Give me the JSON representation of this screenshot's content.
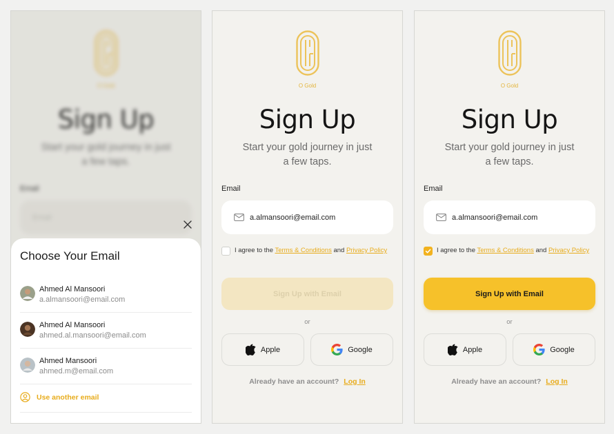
{
  "brand": {
    "name": "O Gold",
    "accent": "#f2b21e"
  },
  "signup": {
    "title": "Sign Up",
    "subtitle": "Start your gold journey in just a few taps.",
    "email_label": "Email",
    "email_placeholder": "Email",
    "email_value": "a.almansoori@email.com",
    "agree_prefix": "I agree to the",
    "terms_link": "Terms & Conditions",
    "agree_and": "and",
    "privacy_link": "Privacy Policy",
    "signup_button": "Sign Up with Email",
    "or": "or",
    "apple_button": "Apple",
    "google_button": "Google",
    "already_text": "Already have an account?",
    "login_link": "Log In"
  },
  "screens": [
    {
      "id": "choose-email",
      "agree_checked": false,
      "signup_enabled": false
    },
    {
      "id": "filled-unchecked",
      "agree_checked": false,
      "signup_enabled": false
    },
    {
      "id": "filled-checked",
      "agree_checked": true,
      "signup_enabled": true
    }
  ],
  "email_sheet": {
    "title": "Choose Your Email",
    "accounts": [
      {
        "name": "Ahmed Al Mansoori",
        "email": "a.almansoori@email.com"
      },
      {
        "name": "Ahmed Al Mansoori",
        "email": "ahmed.al.mansoori@email.com"
      },
      {
        "name": "Ahmed Mansoori",
        "email": "ahmed.m@email.com"
      }
    ],
    "use_another": "Use another email"
  }
}
